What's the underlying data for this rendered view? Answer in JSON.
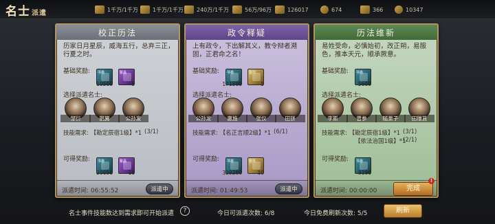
{
  "header": {
    "logo": "名士",
    "subtitle": "派遣",
    "resources": [
      {
        "icon": "grain-icon",
        "value": "1千万/1千万"
      },
      {
        "icon": "wood-icon",
        "value": "1千万/1千万"
      },
      {
        "icon": "iron-icon",
        "value": "240万/1千万"
      },
      {
        "icon": "stone-icon",
        "value": "56万/96万"
      },
      {
        "icon": "sword-icon",
        "value": "126017"
      },
      {
        "icon": "copper-icon",
        "value": "674"
      },
      {
        "icon": "ingot-icon",
        "value": "366"
      },
      {
        "icon": "jade-icon",
        "value": "10347"
      }
    ]
  },
  "labels": {
    "base_reward": "基础奖励:",
    "choose_scholar": "选择派遣名士:",
    "skill_req": "技能需求:",
    "possible_reward": "可得奖励:"
  },
  "cards": [
    {
      "title": "校正历法",
      "desc": "历家日月星辰，威海五行，总弃三正，行夏之时。",
      "base_rewards": [
        {
          "name": "书卷",
          "qty": "10500",
          "color": "teal"
        },
        {
          "name": "紫晶",
          "qty": "5",
          "color": "purple"
        }
      ],
      "heroes": [
        "邹衍",
        "鹊翼",
        "公孙发"
      ],
      "requirements": [
        {
          "text": "【勘定辰宿1级】*1",
          "progress": "(3/1)"
        }
      ],
      "possible_rewards": [
        {
          "name": "书卷",
          "qty": "20650",
          "color": "teal"
        },
        {
          "name": "紫晶",
          "qty": "10",
          "color": "purple"
        }
      ],
      "time_label": "派遣时间: 06:55:52",
      "status": "派遣中"
    },
    {
      "title": "政令释疑",
      "desc": "上有政令，下出解其义，教令辩者溯固，正君命之名！",
      "base_rewards": [
        {
          "name": "书卷",
          "qty": "171500",
          "color": "teal"
        },
        {
          "name": "金币",
          "qty": "5",
          "color": "gold"
        }
      ],
      "heroes": [
        "公孙龙",
        "惠施",
        "张仪",
        "田骈"
      ],
      "requirements": [
        {
          "text": "【名正言顺2级】*1",
          "progress": "(6/1)"
        }
      ],
      "possible_rewards": [
        {
          "name": "书卷",
          "qty": "329280",
          "color": "teal"
        },
        {
          "name": "金币",
          "qty": "10",
          "color": "gold"
        }
      ],
      "time_label": "派遣时间: 01:49:53",
      "status": "派遣中"
    },
    {
      "title": "历法维新",
      "desc": "易姓受命，必慎始初，改正朔，易服色，推本天元，顺承厥意。",
      "base_rewards": [
        {
          "name": "书卷",
          "qty": "5600",
          "color": "teal"
        }
      ],
      "heroes": [
        "李斯",
        "曾参",
        "随巢子",
        "田穰苴"
      ],
      "requirements": [
        {
          "text": "【勘定辰宿1级】*1",
          "progress": "(3/1)"
        },
        {
          "text": "【依法治国1级】*1",
          "progress": "(2/1)"
        }
      ],
      "possible_rewards": [
        {
          "name": "书卷",
          "qty": "8190",
          "color": "teal"
        }
      ],
      "time_label": "派遣时间: 00:00:00",
      "status": "完成",
      "badge": "!"
    }
  ],
  "footer": {
    "hint": "名士事件技能数达到需求即可开始派遣",
    "help": "?",
    "today_dispatch": "今日可派遣次数: 6/8",
    "today_refresh": "今日免费刷新次数: 5/5",
    "refresh_button": "刷新"
  }
}
